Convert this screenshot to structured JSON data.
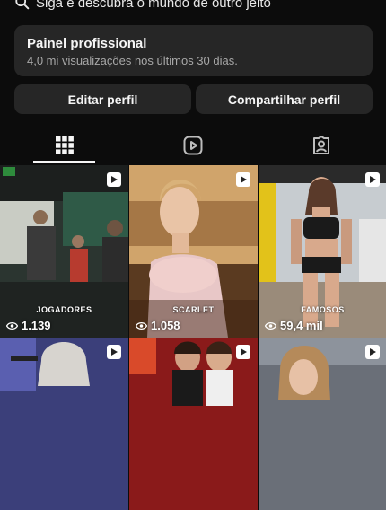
{
  "search_hint": "Siga e descubra o mundo de outro jeito",
  "panel": {
    "title": "Painel profissional",
    "subtitle": "4,0 mi visualizações nos últimos 30 dias."
  },
  "actions": {
    "edit_label": "Editar perfil",
    "share_label": "Compartilhar perfil"
  },
  "tabs": [
    {
      "icon": "grid-icon",
      "active": true
    },
    {
      "icon": "reels-icon",
      "active": false
    },
    {
      "icon": "tagged-icon",
      "active": false
    }
  ],
  "posts": [
    {
      "caption": "JOGADORES",
      "views": "1.139"
    },
    {
      "caption": "SCARLET",
      "views": "1.058"
    },
    {
      "caption": "FAMOSOS",
      "views": "59,4 mil"
    },
    {
      "caption": "",
      "views": ""
    },
    {
      "caption": "",
      "views": ""
    },
    {
      "caption": "",
      "views": ""
    }
  ]
}
